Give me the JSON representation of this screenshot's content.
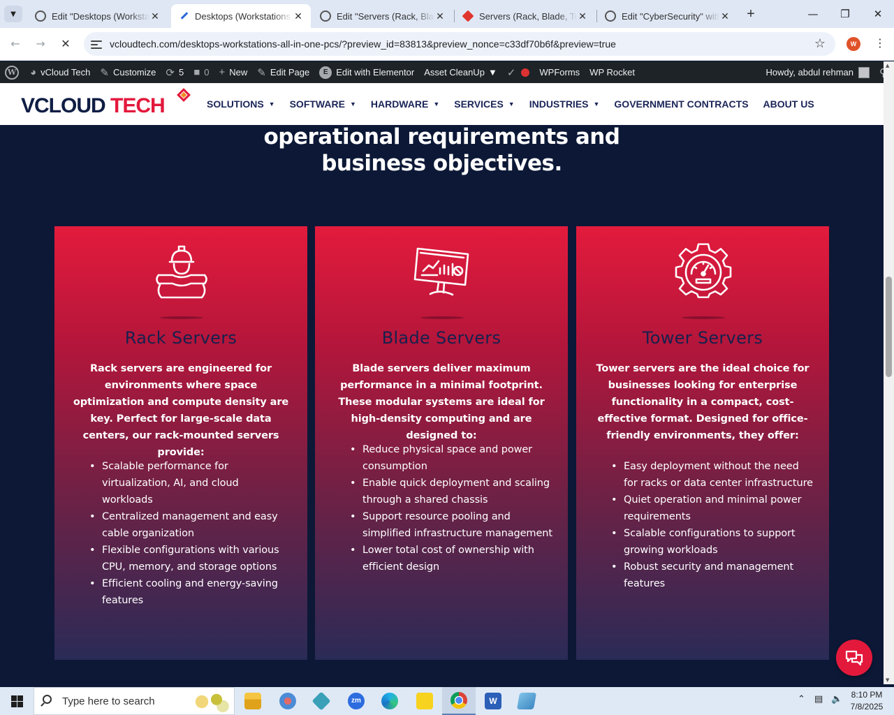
{
  "browser": {
    "tabs": [
      {
        "title": "Edit \"Desktops (Workstations, All-in-One PCs)\"",
        "icon": "wordpress-icon",
        "active": false
      },
      {
        "title": "Desktops (Workstations, All-in-One PCs)",
        "icon": "elementor-pen-icon",
        "active": true
      },
      {
        "title": "Edit \"Servers (Rack, Blade, Tower)\"",
        "icon": "wordpress-icon",
        "active": false
      },
      {
        "title": "Servers (Rack, Blade, Tower)",
        "icon": "vcloud-favicon",
        "active": false
      },
      {
        "title": "Edit \"CyberSecurity\" with Elementor",
        "icon": "wordpress-icon",
        "active": false
      }
    ],
    "url": "vcloudtech.com/desktops-workstations-all-in-one-pcs/?preview_id=83813&preview_nonce=c33df70b6f&preview=true",
    "profile_initial": "W"
  },
  "admin_bar": {
    "site_name": "vCloud Tech",
    "customize": "Customize",
    "updates_count": "5",
    "comments_count": "0",
    "new_label": "New",
    "edit_page": "Edit Page",
    "edit_elementor": "Edit with Elementor",
    "asset_cleanup": "Asset CleanUp",
    "wpforms": "WPForms",
    "wp_rocket": "WP Rocket",
    "howdy": "Howdy, abdul rehman"
  },
  "site": {
    "logo_part1": "VCLOUD",
    "logo_part2": "TECH",
    "nav": [
      {
        "label": "SOLUTIONS",
        "dropdown": true
      },
      {
        "label": "SOFTWARE",
        "dropdown": true
      },
      {
        "label": "HARDWARE",
        "dropdown": true
      },
      {
        "label": "SERVICES",
        "dropdown": true
      },
      {
        "label": "INDUSTRIES",
        "dropdown": true
      },
      {
        "label": "GOVERNMENT CONTRACTS",
        "dropdown": false
      },
      {
        "label": "ABOUT US",
        "dropdown": false
      }
    ]
  },
  "main": {
    "intro_heading": "operational requirements and business objectives.",
    "cards": [
      {
        "icon": "engineer-blueprint-icon",
        "title": "Rack Servers",
        "description": "Rack servers are engineered for environments where space optimization and compute density are key. Perfect for large-scale data centers, our rack-mounted servers provide:",
        "bullets": [
          "Scalable performance for virtualization, AI, and cloud workloads",
          "Centralized management and easy cable organization",
          "Flexible configurations with various CPU, memory, and storage options",
          "Efficient cooling and energy-saving features"
        ]
      },
      {
        "icon": "analytics-monitor-icon",
        "title": "Blade Servers",
        "description": "Blade servers deliver maximum performance in a minimal footprint. These modular systems are ideal for high-density computing and are designed to:",
        "bullets": [
          "Reduce physical space and power consumption",
          "Enable quick deployment and scaling through a shared chassis",
          "Support resource pooling and simplified infrastructure management",
          "Lower total cost of ownership with efficient design"
        ]
      },
      {
        "icon": "gear-gauge-icon",
        "title": "Tower Servers",
        "description": "Tower servers are the ideal choice for businesses looking for enterprise functionality in a compact, cost-effective format. Designed for office-friendly environments, they offer:",
        "bullets": [
          "Easy deployment without the need for racks or data center infrastructure",
          "Quiet operation and minimal power requirements",
          "Scalable configurations to support growing workloads",
          "Robust security and management features"
        ]
      }
    ]
  },
  "taskbar": {
    "search_placeholder": "Type here to search",
    "time": "8:10 PM",
    "date": "7/8/2025"
  },
  "colors": {
    "accent_red": "#e3193c",
    "navy": "#0c1836",
    "card_title": "#17204e"
  }
}
